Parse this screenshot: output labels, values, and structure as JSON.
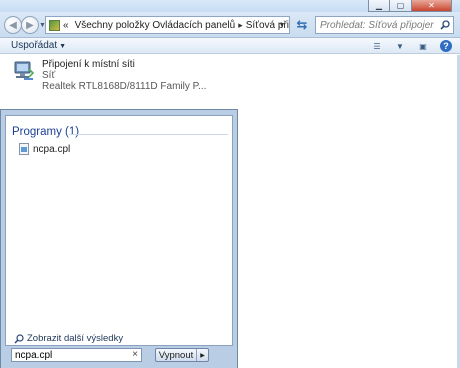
{
  "window": {
    "caption_buttons": [
      "minimize",
      "maximize",
      "close"
    ]
  },
  "address_bar": {
    "overflow_glyph": "«",
    "segments": [
      "Všechny položky Ovládacích panelů",
      "Síťová připojení"
    ]
  },
  "search": {
    "placeholder": "Prohledat: Síťová připojení"
  },
  "command_bar": {
    "organize_label": "Uspořádat"
  },
  "connection": {
    "name": "Připojení k místní síti",
    "status": "Síť",
    "adapter": "Realtek RTL8168D/8111D Family P..."
  },
  "start_menu": {
    "group_heading": "Programy (1)",
    "results": [
      {
        "label": "ncpa.cpl"
      }
    ],
    "more_results_label": "Zobrazit další výsledky",
    "search_value": "ncpa.cpl",
    "shutdown_label": "Vypnout"
  },
  "colors": {
    "group_heading": "#1c3f94",
    "start_menu_bg": "#b9cde4",
    "explorer_nav": "#c9dcf0"
  }
}
